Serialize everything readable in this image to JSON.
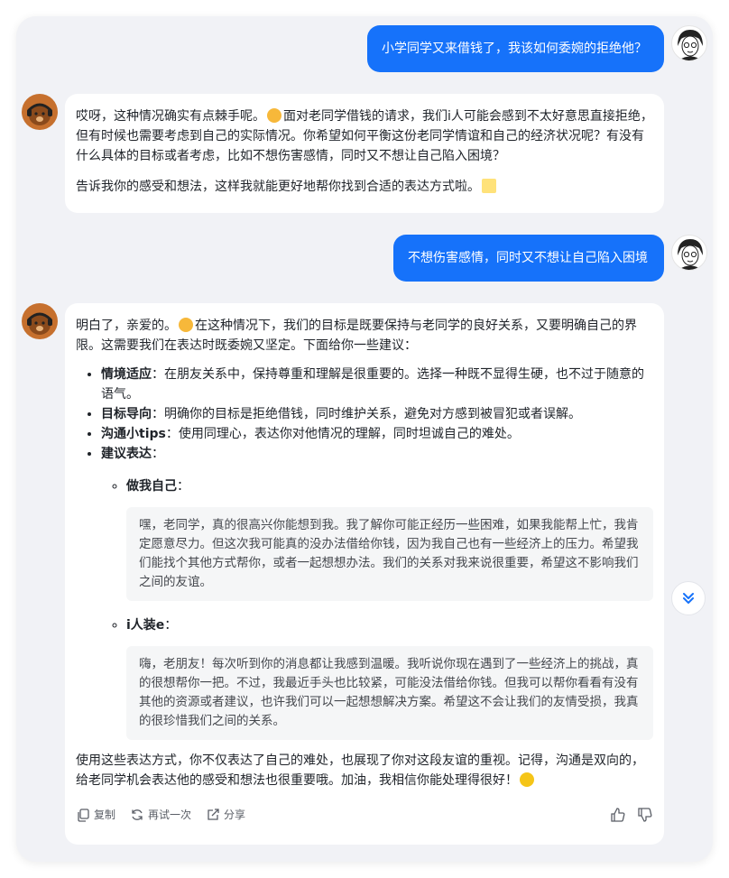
{
  "colors": {
    "user_bubble": "#1672fa",
    "background": "#f1f2f6",
    "bot_avatar": "#c6702e"
  },
  "messages": [
    {
      "role": "user",
      "text": "小学同学又来借钱了，我该如何委婉的拒绝他？"
    },
    {
      "role": "assistant",
      "p1a": "哎呀，这种情况确实有点棘手呢。",
      "p1b": "面对老同学借钱的请求，我们i人可能会感到不太好意思直接拒绝，但有时候也需要考虑到自己的实际情况。你希望如何平衡这份老同学情谊和自己的经济状况呢？有没有什么具体的目标或者考虑，比如不想伤害感情，同时又不想让自己陷入困境？",
      "p2": "告诉我你的感受和想法，这样我就能更好地帮你找到合适的表达方式啦。"
    },
    {
      "role": "user",
      "text": "不想伤害感情，同时又不想让自己陷入困境"
    },
    {
      "role": "assistant",
      "intro_a": "明白了，亲爱的。",
      "intro_b": "在这种情况下，我们的目标是既要保持与老同学的良好关系，又要明确自己的界限。这需要我们在表达时既委婉又坚定。下面给你一些建议：",
      "points": [
        {
          "title": "情境适应",
          "text": "：在朋友关系中，保持尊重和理解是很重要的。选择一种既不显得生硬，也不过于随意的语气。"
        },
        {
          "title": "目标导向",
          "text": "：明确你的目标是拒绝借钱，同时维护关系，避免对方感到被冒犯或者误解。"
        },
        {
          "title": "沟通小tips",
          "text": "：使用同理心，表达你对他情况的理解，同时坦诚自己的难处。"
        },
        {
          "title": "建议表达",
          "text": "："
        }
      ],
      "options": [
        {
          "title": "做我自己",
          "suffix": "：",
          "quote": "嘿，老同学，真的很高兴你能想到我。我了解你可能正经历一些困难，如果我能帮上忙，我肯定愿意尽力。但这次我可能真的没办法借给你钱，因为我自己也有一些经济上的压力。希望我们能找个其他方式帮你，或者一起想想办法。我们的关系对我来说很重要，希望这不影响我们之间的友谊。"
        },
        {
          "title": "i人装e",
          "suffix": "：",
          "quote": "嗨，老朋友！每次听到你的消息都让我感到温暖。我听说你现在遇到了一些经济上的挑战，真的很想帮你一把。不过，我最近手头也比较紧，可能没法借给你钱。但我可以帮你看看有没有其他的资源或者建议，也许我们可以一起想想解决方案。希望这不会让我们的友情受损，我真的很珍惜我们之间的关系。"
        }
      ],
      "outro": "使用这些表达方式，你不仅表达了自己的难处，也展现了你对这段友谊的重视。记得，沟通是双向的，给老同学机会表达他的感受和想法也很重要哦。加油，我相信你能处理得很好！"
    }
  ],
  "actions": {
    "copy": "复制",
    "retry": "再试一次",
    "share": "分享"
  },
  "icons": [
    "copy-icon",
    "retry-icon",
    "share-icon",
    "thumbs-up-icon",
    "thumbs-down-icon",
    "scroll-down-icon"
  ]
}
